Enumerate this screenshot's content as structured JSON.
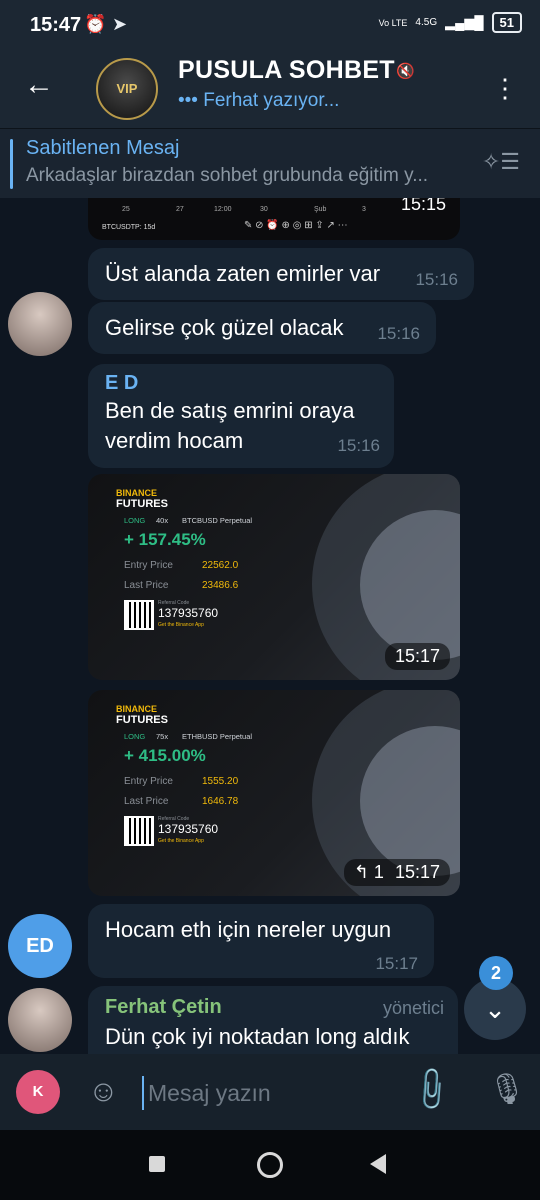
{
  "status_bar": {
    "time": "15:47",
    "alarm_icon": "alarm-icon",
    "telegram_icon": "telegram-icon",
    "network": "4.5G",
    "volte": "Vo LTE",
    "battery": "51"
  },
  "header": {
    "back_icon": "back-arrow-icon",
    "avatar_label": "VIP",
    "title": "PUSULA SOHBET",
    "mute_icon": "mute-icon",
    "status": "••• Ferhat yazıyor...",
    "menu_icon": "more-vertical-icon"
  },
  "pinned": {
    "title": "Sabitlenen Mesaj",
    "text": "Arkadaşlar birazdan sohbet grubunda eğitim y...",
    "icon": "pinned-list-icon"
  },
  "messages": [
    {
      "type": "image_partial",
      "time": "15:15",
      "chart_labels": [
        "25",
        "27",
        "12:00",
        "30",
        "Şub",
        "3"
      ],
      "pair_label": "BTCUSDTP: 15d"
    },
    {
      "type": "text",
      "text": "Üst alanda zaten emirler var",
      "time": "15:16"
    },
    {
      "type": "text",
      "text": "Gelirse çok güzel olacak",
      "time": "15:16"
    },
    {
      "type": "text",
      "sender": "E D",
      "text": "Ben de satış emrini oraya verdim hocam",
      "time": "15:16"
    },
    {
      "type": "image",
      "time": "15:17",
      "card": {
        "brand": "BINANCE",
        "product": "FUTURES",
        "side": "LONG",
        "leverage": "40x",
        "pair": "BTCBUSD Perpetual",
        "pnl": "+ 157.45%",
        "entry_label": "Entry Price",
        "entry": "22562.0",
        "last_label": "Last Price",
        "last": "23486.6",
        "ref_label": "Referral Code",
        "ref_code": "137935760",
        "app_label": "Get the Binance App"
      }
    },
    {
      "type": "image",
      "time": "15:17",
      "replies": "1",
      "card": {
        "brand": "BINANCE",
        "product": "FUTURES",
        "side": "LONG",
        "leverage": "75x",
        "pair": "ETHBUSD Perpetual",
        "pnl": "+ 415.00%",
        "entry_label": "Entry Price",
        "entry": "1555.20",
        "last_label": "Last Price",
        "last": "1646.78",
        "ref_label": "Referral Code",
        "ref_code": "137935760",
        "app_label": "Get the Binance App"
      }
    },
    {
      "type": "text",
      "avatar": "ED",
      "text": "Hocam eth için nereler uygun",
      "time": "15:17"
    },
    {
      "type": "text",
      "sender": "Ferhat Çetin",
      "role": "yönetici",
      "text": "Dün çok iyi noktadan long aldık"
    }
  ],
  "scroll_down": {
    "icon": "chevron-down-icon",
    "unread": "2"
  },
  "composer": {
    "avatar_label": "K",
    "sticker_icon": "sticker-icon",
    "placeholder": "Mesaj yazın",
    "attach_icon": "paperclip-icon",
    "mic_icon": "microphone-icon"
  },
  "colors": {
    "accent": "#6ab3f3",
    "bubble": "#182533",
    "background": "#0e1621",
    "header": "#1c2733",
    "sender_green": "#86c37a",
    "binance_yellow": "#f0b90b",
    "profit_green": "#2ebd85"
  }
}
